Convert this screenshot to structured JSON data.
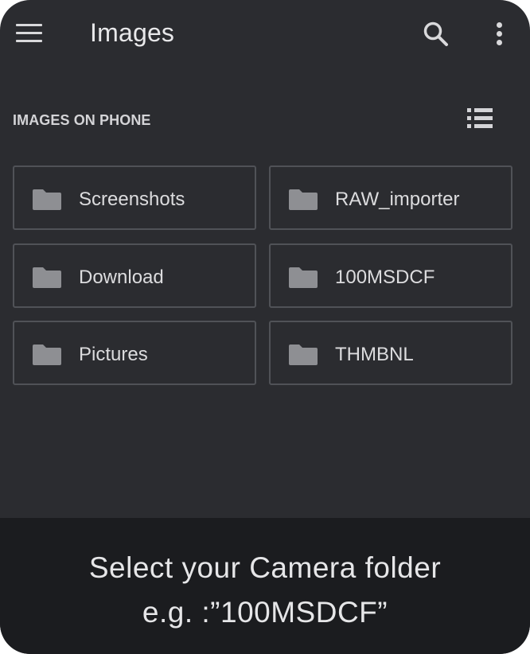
{
  "app_bar": {
    "title": "Images",
    "menu_icon": "menu-icon",
    "search_icon": "search-icon",
    "more_icon": "more-vertical-icon"
  },
  "section": {
    "title": "IMAGES ON PHONE",
    "view_toggle_icon": "list-view-icon"
  },
  "folders": [
    {
      "label": "Screenshots",
      "icon": "folder-icon"
    },
    {
      "label": "RAW_importer",
      "icon": "folder-icon"
    },
    {
      "label": "Download",
      "icon": "folder-icon"
    },
    {
      "label": "100MSDCF",
      "icon": "folder-icon"
    },
    {
      "label": "Pictures",
      "icon": "folder-icon"
    },
    {
      "label": "THMBNL",
      "icon": "folder-icon"
    }
  ],
  "caption": {
    "line1": "Select your Camera folder",
    "line2": "e.g. :”100MSDCF”"
  },
  "colors": {
    "background": "#2b2c30",
    "caption_background": "#1b1c1f",
    "folder_border": "#505257",
    "folder_icon": "#8e8f93",
    "text": "#dcdcde"
  }
}
